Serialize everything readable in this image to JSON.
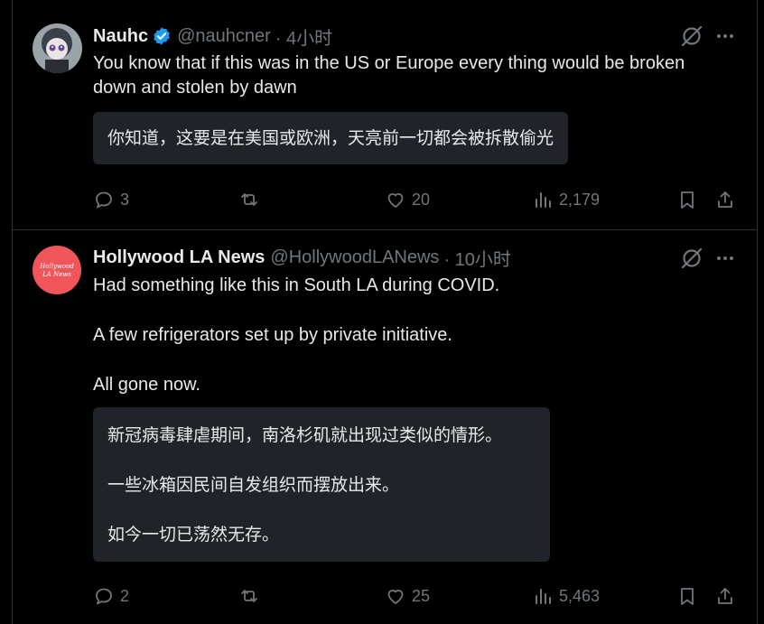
{
  "posts": [
    {
      "name": "Nauhc",
      "handle": "@nauhcner",
      "time": "· 4小时",
      "text": "You know that if this was in the US or Europe every thing would be broken down and stolen by dawn",
      "translation": [
        "你知道，这要是在美国或欧洲，天亮前一切都会被拆散偷光"
      ],
      "replies": "3",
      "likes": "20",
      "views": "2,179"
    },
    {
      "name": "Hollywood LA News",
      "handle": "@HollywoodLANews",
      "time": "· 10小时",
      "avatar_text": "Hollywood LA News",
      "avatar_color": "#f0555a",
      "text": [
        "Had something like this in South LA during COVID.",
        "A few refrigerators set up by private initiative.",
        "All gone now."
      ],
      "translation": [
        "新冠病毒肆虐期间，南洛杉矶就出现过类似的情形。",
        "一些冰箱因民间自发组织而摆放出来。",
        "如今一切已荡然无存。"
      ],
      "replies": "2",
      "likes": "25",
      "views": "5,463"
    }
  ],
  "colors": {
    "background": "#000000",
    "text": "#e7e9ea",
    "muted": "#71767b",
    "verified": "#1d9bf0",
    "translation_bg": "#202327"
  }
}
